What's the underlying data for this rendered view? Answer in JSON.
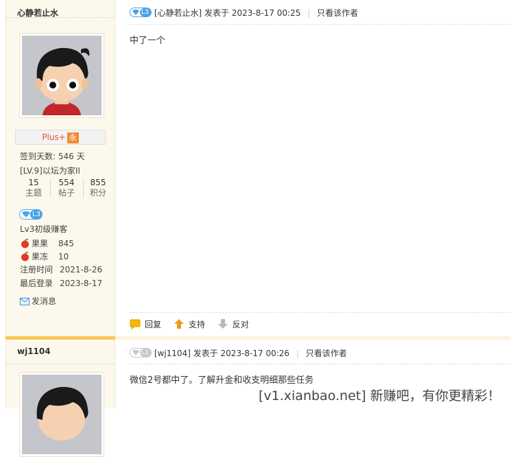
{
  "post1": {
    "username": "心静若止水",
    "level_badge": "L3",
    "plus_label": "Plus+",
    "yong_label": "永",
    "sign_days": "签到天数: 546 天",
    "rank": "[LV.9]以坛为家II",
    "stats": [
      {
        "value": "15",
        "label": "主题"
      },
      {
        "value": "554",
        "label": "帖子"
      },
      {
        "value": "855",
        "label": "积分"
      }
    ],
    "lv_title": "Lv3初级赚客",
    "fields": [
      {
        "key": "果果",
        "value": "845"
      },
      {
        "key": "果冻",
        "value": "10"
      },
      {
        "key": "注册时间",
        "value": "2021-8-26"
      },
      {
        "key": "最后登录",
        "value": "2023-8-17"
      }
    ],
    "send_msg": "发消息",
    "header_user": "[心静若止水]",
    "header_posted": "发表于 2023-8-17 00:25",
    "only_author": "只看该作者",
    "body": "中了一个",
    "actions": {
      "reply": "回复",
      "support": "支持",
      "oppose": "反对"
    }
  },
  "post2": {
    "username": "wj1104",
    "level_badge": "L1",
    "header_user": "[wj1104]",
    "header_posted": "发表于 2023-8-17 00:26",
    "only_author": "只看该作者",
    "body": "微信2号都中了。了解升金和收支明细那些任务"
  },
  "watermark": "[v1.xianbao.net] 新赚吧，有你更精彩！",
  "colors": {
    "accent": "#f7c655",
    "badge_blue": "#4aa3e8",
    "badge_gray": "#c8c8c8",
    "plus_red": "#e5523a"
  }
}
